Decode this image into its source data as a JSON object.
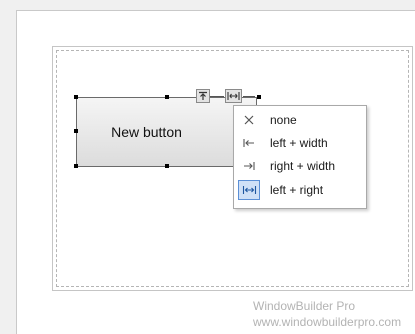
{
  "button": {
    "label": "New button"
  },
  "anchor_toolbar": {
    "vertical_anchor_icon": "arrow-up-icon",
    "horizontal_anchor_icon": "left-right-anchor-icon"
  },
  "anchor_menu": {
    "items": [
      {
        "label": "none",
        "icon": "cross-icon",
        "glyph": "✕",
        "selected": false
      },
      {
        "label": "left + width",
        "icon": "left-anchor-icon",
        "glyph": "|←",
        "selected": false
      },
      {
        "label": "right + width",
        "icon": "right-anchor-icon",
        "glyph": "→|",
        "selected": false
      },
      {
        "label": "left + right",
        "icon": "left-right-anchor-icon",
        "glyph": "|↔|",
        "selected": true
      }
    ]
  },
  "footer": {
    "title": "WindowBuilder Pro",
    "url": "www.windowbuilderpro.com"
  },
  "colors": {
    "selection_highlight": "#cfe0f7",
    "selection_border": "#5b8fd6"
  }
}
